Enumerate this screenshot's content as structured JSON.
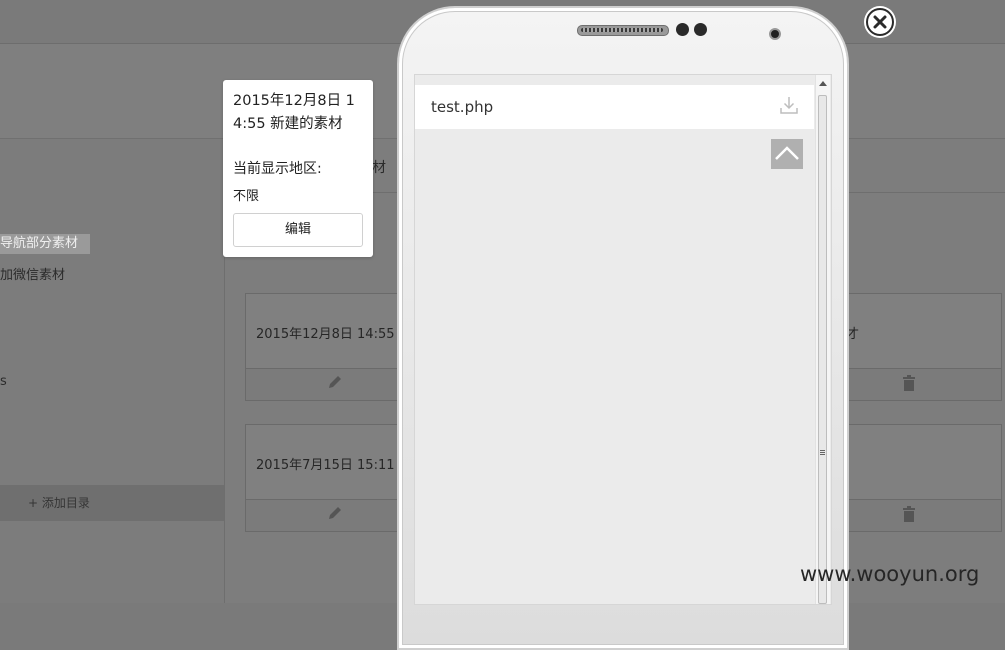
{
  "background": {
    "sidebar_highlight": "导航部分素材",
    "sidebar_item": "加微信素材",
    "sidebar_dot": "s",
    "add_dir": "+ 添加目录",
    "material_title_suffix": "材",
    "card1_text": "2015年12月8日 14:55",
    "card1_right_text": "才",
    "card2_text": "2015年7月15日 15:11"
  },
  "tooltip": {
    "title": "2015年12月8日 14:55 新建的素材",
    "region_label": "当前显示地区:",
    "region_value": "不限",
    "edit_button": "编辑"
  },
  "phone": {
    "file_name": "test.php"
  },
  "watermark": "www.wooyun.org",
  "icons": {
    "close": "close-icon",
    "download": "download-icon",
    "back_to_top": "chevron-up-icon",
    "edit": "pencil-icon",
    "delete": "trash-icon"
  }
}
